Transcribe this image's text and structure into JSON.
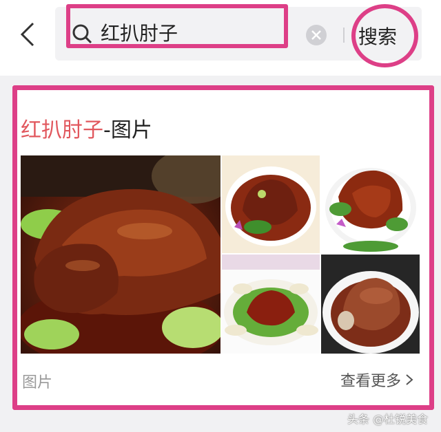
{
  "search": {
    "query": "红扒肘子",
    "button_label": "搜索"
  },
  "result_card": {
    "title_keyword": "红扒肘子",
    "title_suffix": "-图片",
    "footer_label": "图片",
    "more_label": "查看更多"
  },
  "watermark": "头条 @杜锐美食",
  "colors": {
    "highlight": "#dd3f87",
    "keyword": "#e1575d"
  },
  "icons": [
    "back-arrow-icon",
    "search-icon",
    "clear-icon",
    "chevron-right-icon"
  ]
}
